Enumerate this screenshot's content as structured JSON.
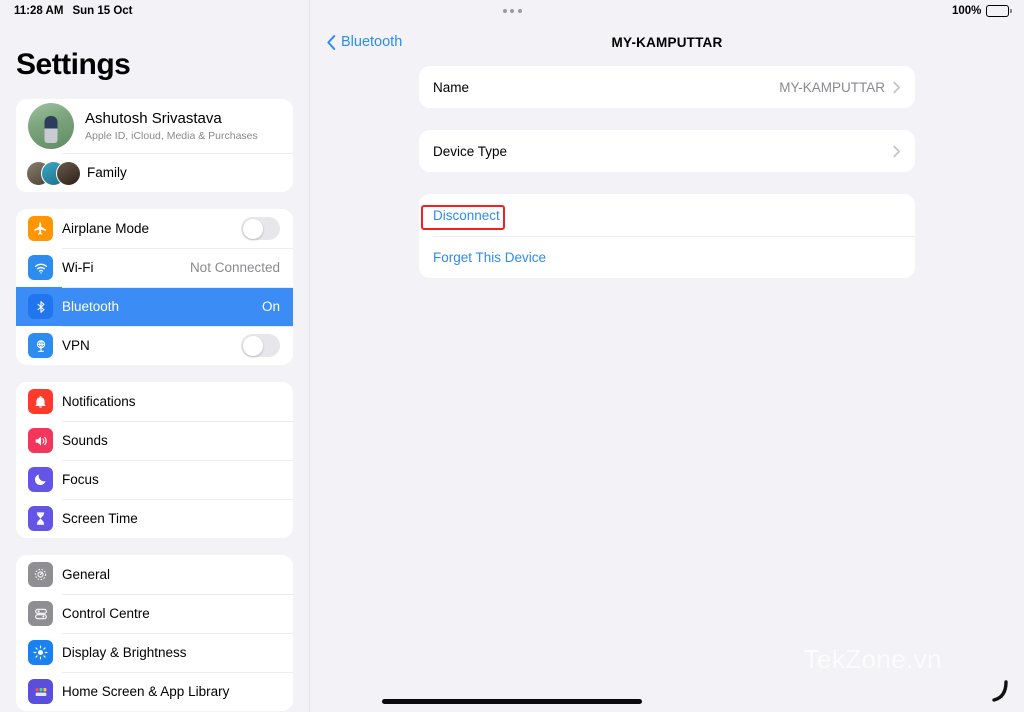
{
  "status_bar": {
    "time": "11:28 AM",
    "date": "Sun 15 Oct",
    "battery_percent": "100%",
    "battery_icon": "battery-full-icon",
    "multitask_icon": "multitask-dots-icon"
  },
  "sidebar": {
    "title": "Settings",
    "account": {
      "name": "Ashutosh Srivastava",
      "subtitle": "Apple ID, iCloud, Media & Purchases",
      "avatar_icon": "user-avatar",
      "family_label": "Family",
      "family_avatars_icon": "family-avatars"
    },
    "groups": [
      {
        "items": [
          {
            "label": "Airplane Mode",
            "icon": "airplane-icon",
            "icon_color": "#ff9500",
            "control": "toggle",
            "toggle_on": false
          },
          {
            "label": "Wi-Fi",
            "icon": "wifi-icon",
            "icon_color": "#2d8cf0",
            "value": "Not Connected"
          },
          {
            "label": "Bluetooth",
            "icon": "bluetooth-icon",
            "icon_color": "#2d8cf0",
            "value": "On",
            "selected": true
          },
          {
            "label": "VPN",
            "icon": "vpn-globe-icon",
            "icon_color": "#2d8cf0",
            "control": "toggle",
            "toggle_on": false
          }
        ]
      },
      {
        "items": [
          {
            "label": "Notifications",
            "icon": "bell-icon",
            "icon_color": "#fc3b2d"
          },
          {
            "label": "Sounds",
            "icon": "speaker-icon",
            "icon_color": "#f2365c"
          },
          {
            "label": "Focus",
            "icon": "moon-icon",
            "icon_color": "#6455e8"
          },
          {
            "label": "Screen Time",
            "icon": "hourglass-icon",
            "icon_color": "#6455e8"
          }
        ]
      },
      {
        "items": [
          {
            "label": "General",
            "icon": "gear-icon",
            "icon_color": "#8e8e93"
          },
          {
            "label": "Control Centre",
            "icon": "control-centre-icon",
            "icon_color": "#8e8e93"
          },
          {
            "label": "Display & Brightness",
            "icon": "brightness-icon",
            "icon_color": "#1a82f0"
          },
          {
            "label": "Home Screen & App Library",
            "icon": "home-screen-icon",
            "icon_color": "#5a4fdc"
          }
        ]
      }
    ]
  },
  "detail": {
    "back_label": "Bluetooth",
    "back_icon": "chevron-left-icon",
    "title": "MY-KAMPUTTAR",
    "rows": {
      "name_label": "Name",
      "name_value": "MY-KAMPUTTAR",
      "device_type_label": "Device Type",
      "disconnect_label": "Disconnect",
      "forget_label": "Forget This Device"
    },
    "chevron_icon": "chevron-right-icon"
  },
  "annotation": {
    "color": "#f41f1f",
    "target": "disconnect-button"
  },
  "watermark": {
    "text": "TekZone.vn"
  }
}
